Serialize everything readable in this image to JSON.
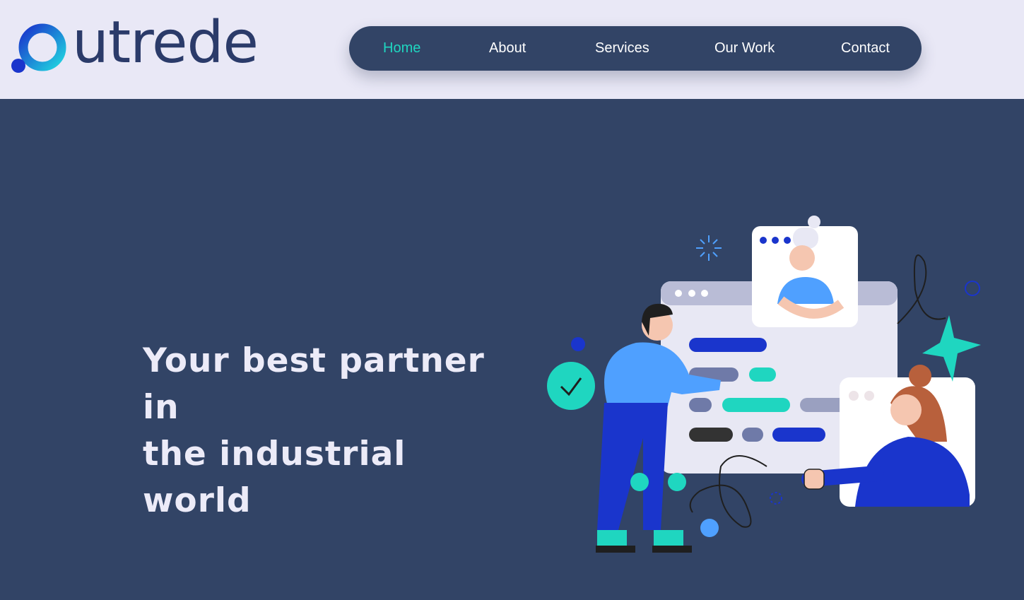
{
  "brand": {
    "name": "utrede"
  },
  "nav": {
    "items": [
      {
        "label": "Home",
        "active": true
      },
      {
        "label": "About",
        "active": false
      },
      {
        "label": "Services",
        "active": false
      },
      {
        "label": "Our Work",
        "active": false
      },
      {
        "label": "Contact",
        "active": false
      }
    ]
  },
  "hero": {
    "title_line1": "Your best partner in",
    "title_line2": "the industrial world"
  },
  "colors": {
    "header_bg": "#e9e8f6",
    "hero_bg": "#324466",
    "nav_bg": "#324466",
    "accent": "#1fd6c0",
    "brand_blue": "#1a35cc",
    "logo_text": "#2b3b6a"
  }
}
